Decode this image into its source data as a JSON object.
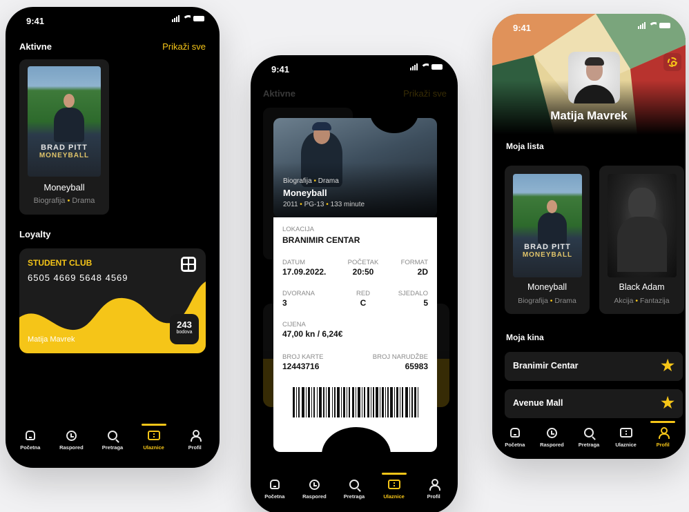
{
  "status": {
    "time": "9:41"
  },
  "colors": {
    "accent": "#f5c518",
    "background": "#000000",
    "card": "#1b1b1b"
  },
  "tabs": [
    {
      "label": "Početna",
      "icon": "home-icon"
    },
    {
      "label": "Raspored",
      "icon": "clock-icon"
    },
    {
      "label": "Pretraga",
      "icon": "search-icon"
    },
    {
      "label": "Ulaznice",
      "icon": "ticket-icon"
    },
    {
      "label": "Profil",
      "icon": "user-icon"
    }
  ],
  "screen1": {
    "active_title": "Aktivne",
    "show_all": "Prikaži sve",
    "active_movie": {
      "title": "Moneyball",
      "genre1": "Biografija",
      "genre2": "Drama"
    },
    "poster_text": {
      "line1": "BRAD PITT",
      "line2": "MONEYBALL"
    },
    "loyalty_title": "Loyalty",
    "loyalty_card": {
      "club": "STUDENT CLUB",
      "number": "6505 4669 5648 4569",
      "holder": "Matija Mavrek",
      "points": "243",
      "points_label": "bodova"
    },
    "active_tab": "Ulaznice"
  },
  "screen2": {
    "movie": {
      "genre1": "Biografija",
      "genre2": "Drama",
      "title": "Moneyball",
      "year": "2011",
      "rating": "PG-13",
      "duration": "133 minute"
    },
    "location_label": "LOKACIJA",
    "location": "BRANIMIR CENTAR",
    "date_label": "DATUM",
    "date": "17.09.2022.",
    "start_label": "POČETAK",
    "start": "20:50",
    "format_label": "FORMAT",
    "format": "2D",
    "hall_label": "DVORANA",
    "hall": "3",
    "row_label": "RED",
    "row": "C",
    "seat_label": "SJEDALO",
    "seat": "5",
    "price_label": "CIJENA",
    "price": "47,00 kn / 6,24€",
    "ticket_no_label": "BROJ KARTE",
    "ticket_no": "12443716",
    "order_no_label": "BROJ NARUDŽBE",
    "order_no": "65983",
    "active_tab": "Ulaznice"
  },
  "screen3": {
    "name": "Matija Mavrek",
    "list_title": "Moja lista",
    "list": [
      {
        "title": "Moneyball",
        "genre1": "Biografija",
        "genre2": "Drama"
      },
      {
        "title": "Black Adam",
        "genre1": "Akcija",
        "genre2": "Fantazija"
      }
    ],
    "poster_text": {
      "line1": "BRAD PITT",
      "line2": "MONEYBALL"
    },
    "cinemas_title": "Moja kina",
    "cinemas": [
      {
        "name": "Branimir Centar"
      },
      {
        "name": "Avenue Mall"
      }
    ],
    "active_tab": "Profil"
  }
}
